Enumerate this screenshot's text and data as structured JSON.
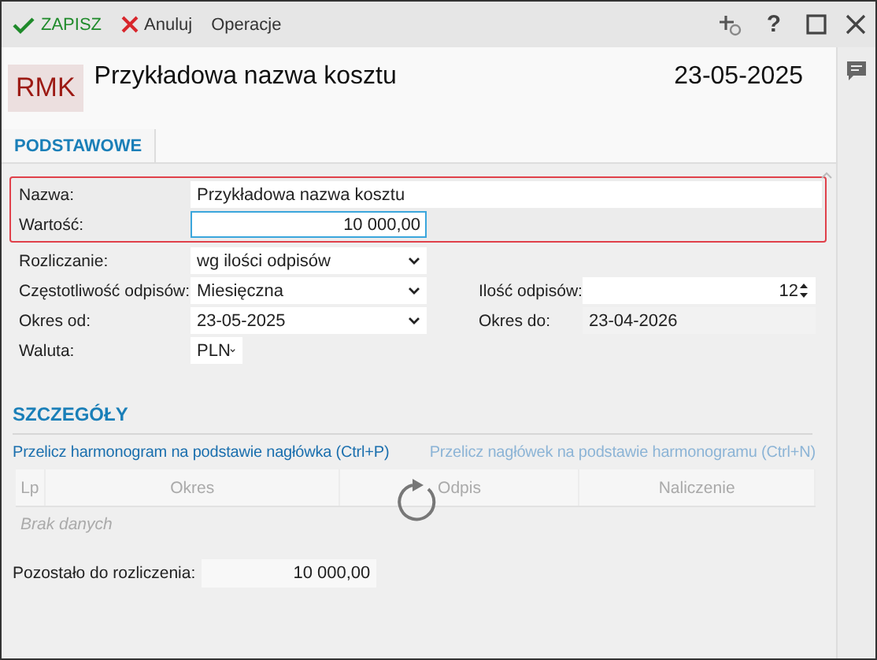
{
  "toolbar": {
    "actions": [
      {
        "kind": "save",
        "label": "ZAPISZ"
      },
      {
        "kind": "cancel",
        "label": "Anuluj"
      },
      {
        "kind": "menu",
        "label": "Operacje"
      }
    ],
    "window_icons": [
      {
        "kind": "add-link"
      },
      {
        "kind": "help",
        "label": "?"
      },
      {
        "kind": "maximize"
      },
      {
        "kind": "close"
      }
    ]
  },
  "header": {
    "badge": "RMK",
    "title": "Przykładowa nazwa kosztu",
    "date": "23-05-2025"
  },
  "tabs": [
    {
      "label": "PODSTAWOWE",
      "selected": true
    }
  ],
  "groups": [
    {
      "highlighted": true,
      "rows": [
        {
          "label": "Nazwa:",
          "field": {
            "kind": "text",
            "value": "Przykładowa nazwa kosztu",
            "wide": true,
            "focused": false
          }
        },
        {
          "label": "Wartość:",
          "field": {
            "kind": "number",
            "value": "10 000,00",
            "focused": true
          }
        }
      ]
    },
    {
      "highlighted": false,
      "rows": [
        {
          "label": "Rozliczanie:",
          "field": {
            "kind": "select",
            "value": "wg ilości odpisów",
            "focused": false
          }
        },
        {
          "label": "Częstotliwość odpisów:",
          "field": {
            "kind": "select",
            "value": "Miesięczna",
            "focused": false
          },
          "label_2": "Ilość odpisów:",
          "field_2": {
            "kind": "spin",
            "value": "12",
            "focused": false
          }
        },
        {
          "label": "Okres od:",
          "field": {
            "kind": "select",
            "value": "23-05-2025",
            "focused": false
          },
          "label_2": "Okres do:",
          "field_2": {
            "kind": "readonly",
            "value": "23-04-2026",
            "focused": false
          }
        },
        {
          "label": "Waluta:",
          "field": {
            "kind": "small-select",
            "value": "PLN",
            "focused": false
          }
        }
      ]
    }
  ],
  "details": {
    "heading": "SZCZEGÓŁY",
    "links": [
      {
        "label": "Przelicz harmonogram na podstawie nagłówka (Ctrl+P)",
        "disabled": false
      },
      {
        "label": "Przelicz nagłówek na podstawie harmonogramu (Ctrl+N)",
        "disabled": true
      }
    ],
    "table": {
      "columns": [
        "Lp",
        "Okres",
        "Odpis",
        "Naliczenie"
      ],
      "empty_text": "Brak danych",
      "loading": true
    },
    "remaining": {
      "label": "Pozostało do rozliczenia:",
      "value": "10 000,00"
    }
  }
}
